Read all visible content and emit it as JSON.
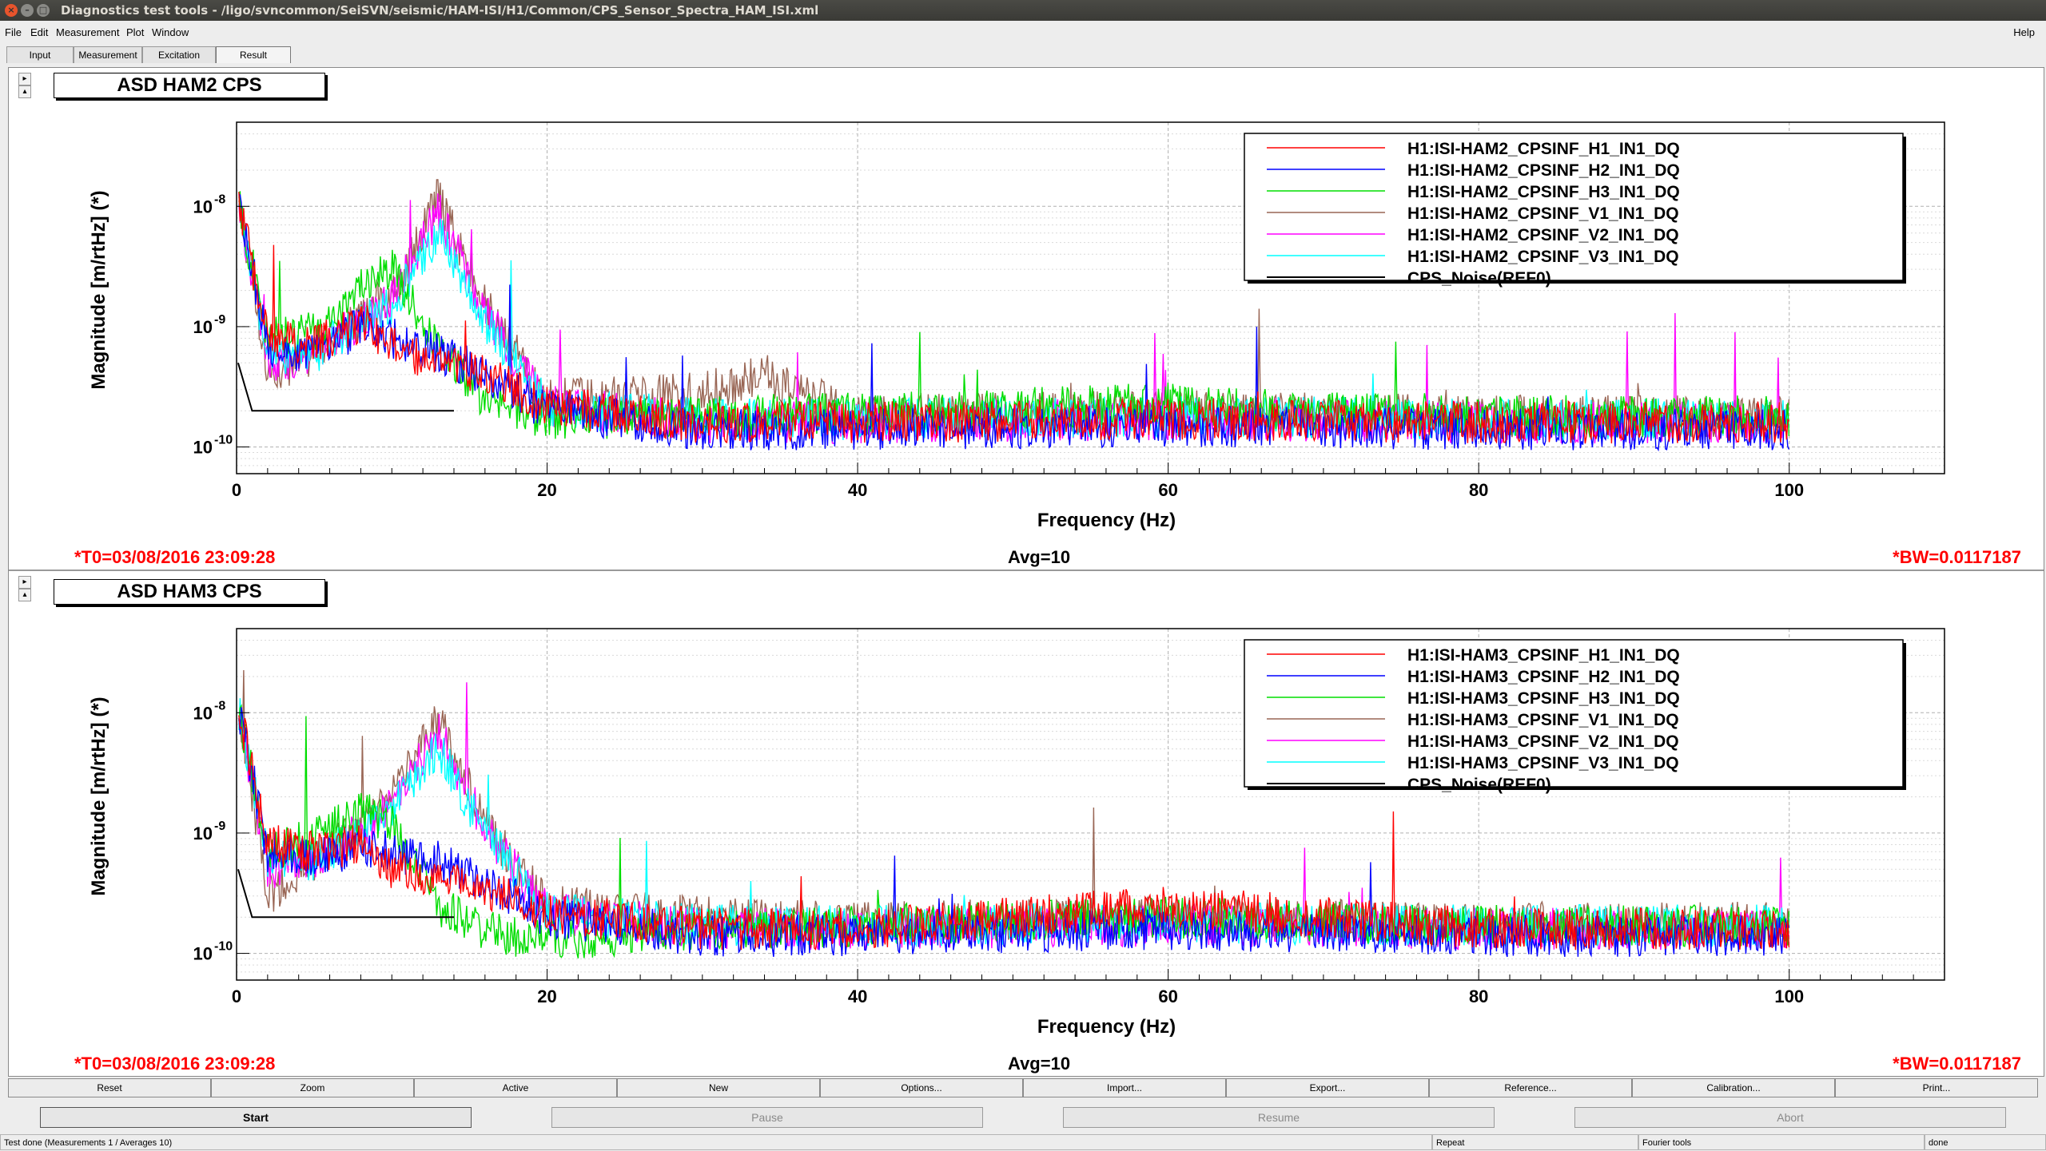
{
  "window": {
    "title": "Diagnostics test tools - /ligo/svncommon/SeiSVN/seismic/HAM-ISI/H1/Common/CPS_Sensor_Spectra_HAM_ISI.xml"
  },
  "menu": {
    "items": [
      "File",
      "Edit",
      "Measurement",
      "Plot",
      "Window"
    ],
    "help": "Help"
  },
  "tabs": [
    {
      "label": "Input"
    },
    {
      "label": "Measurement"
    },
    {
      "label": "Excitation"
    },
    {
      "label": "Result"
    }
  ],
  "panels": [
    {
      "title": "ASD HAM2 CPS",
      "t0": "*T0=03/08/2016 23:09:28",
      "avg": "Avg=10",
      "bw": "*BW=0.0117187",
      "legend": [
        {
          "name": "H1:ISI-HAM2_CPSINF_H1_IN1_DQ",
          "color": "#ff0000"
        },
        {
          "name": "H1:ISI-HAM2_CPSINF_H2_IN1_DQ",
          "color": "#0000ff"
        },
        {
          "name": "H1:ISI-HAM2_CPSINF_H3_IN1_DQ",
          "color": "#00dd00"
        },
        {
          "name": "H1:ISI-HAM2_CPSINF_V1_IN1_DQ",
          "color": "#996655"
        },
        {
          "name": "H1:ISI-HAM2_CPSINF_V2_IN1_DQ",
          "color": "#ff00ff"
        },
        {
          "name": "H1:ISI-HAM2_CPSINF_V3_IN1_DQ",
          "color": "#00ffff"
        },
        {
          "name": "CPS_Noise(REF0)",
          "color": "#000000"
        }
      ]
    },
    {
      "title": "ASD HAM3 CPS",
      "t0": "*T0=03/08/2016 23:09:28",
      "avg": "Avg=10",
      "bw": "*BW=0.0117187",
      "legend": [
        {
          "name": "H1:ISI-HAM3_CPSINF_H1_IN1_DQ",
          "color": "#ff0000"
        },
        {
          "name": "H1:ISI-HAM3_CPSINF_H2_IN1_DQ",
          "color": "#0000ff"
        },
        {
          "name": "H1:ISI-HAM3_CPSINF_H3_IN1_DQ",
          "color": "#00dd00"
        },
        {
          "name": "H1:ISI-HAM3_CPSINF_V1_IN1_DQ",
          "color": "#996655"
        },
        {
          "name": "H1:ISI-HAM3_CPSINF_V2_IN1_DQ",
          "color": "#ff00ff"
        },
        {
          "name": "H1:ISI-HAM3_CPSINF_V3_IN1_DQ",
          "color": "#00ffff"
        },
        {
          "name": "CPS_Noise(REF0)",
          "color": "#000000"
        }
      ]
    }
  ],
  "axes": {
    "xlabel": "Frequency (Hz)",
    "ylabel": "Magnitude [m/rtHz] (*)",
    "xticks": [
      "0",
      "20",
      "40",
      "60",
      "80",
      "100"
    ],
    "yticks": [
      "10",
      "10",
      "10"
    ],
    "ytick_exponents": [
      "-8",
      "-9",
      "-10"
    ]
  },
  "chart_data": [
    {
      "type": "line",
      "title": "ASD HAM2 CPS",
      "xlabel": "Frequency (Hz)",
      "ylabel": "Magnitude [m/rtHz] (*)",
      "xlim": [
        0,
        110
      ],
      "ylim": [
        6e-11,
        5e-08
      ],
      "yscale": "log",
      "grid": true,
      "legend_position": "top-right",
      "series": [
        {
          "name": "H1:ISI-HAM2_CPSINF_H1_IN1_DQ",
          "x": [
            0.2,
            2,
            5,
            8,
            10,
            13,
            16,
            20,
            30,
            40,
            60,
            80,
            100
          ],
          "y": [
            1e-08,
            8e-10,
            7e-10,
            1.1e-09,
            7e-10,
            5e-10,
            4e-10,
            2.2e-10,
            1.6e-10,
            1.6e-10,
            1.7e-10,
            1.6e-10,
            1.6e-10
          ]
        },
        {
          "name": "H1:ISI-HAM2_CPSINF_H2_IN1_DQ",
          "x": [
            0.2,
            2,
            5,
            8,
            10,
            13,
            16,
            20,
            30,
            40,
            60,
            80,
            100
          ],
          "y": [
            1e-08,
            7e-10,
            6e-10,
            1e-09,
            8e-10,
            6e-10,
            4e-10,
            2e-10,
            1.4e-10,
            1.4e-10,
            1.5e-10,
            1.4e-10,
            1.4e-10
          ]
        },
        {
          "name": "H1:ISI-HAM2_CPSINF_H3_IN1_DQ",
          "x": [
            0.2,
            2,
            5,
            8,
            10,
            13,
            16,
            20,
            30,
            40,
            60,
            80,
            100
          ],
          "y": [
            1e-08,
            8e-10,
            9e-10,
            2e-09,
            3e-09,
            7e-10,
            2.5e-10,
            1.7e-10,
            1.8e-10,
            1.9e-10,
            2.3e-10,
            1.8e-10,
            1.8e-10
          ]
        },
        {
          "name": "H1:ISI-HAM2_CPSINF_V1_IN1_DQ",
          "x": [
            0.2,
            2,
            5,
            8,
            10,
            13,
            16,
            20,
            30,
            34,
            40,
            60,
            80,
            100
          ],
          "y": [
            1e-08,
            4e-10,
            6e-10,
            1.2e-09,
            1.8e-09,
            1.2e-08,
            1.5e-09,
            2.5e-10,
            2.8e-10,
            4e-10,
            1.8e-10,
            2e-10,
            1.8e-10,
            1.8e-10
          ]
        },
        {
          "name": "H1:ISI-HAM2_CPSINF_V2_IN1_DQ",
          "x": [
            0.2,
            2,
            5,
            8,
            10,
            13,
            16,
            20,
            30,
            40,
            60,
            80,
            100
          ],
          "y": [
            1e-08,
            5e-10,
            6e-10,
            1.1e-09,
            1.6e-09,
            9e-09,
            1.3e-09,
            2.2e-10,
            1.6e-10,
            1.6e-10,
            1.7e-10,
            1.6e-10,
            1.6e-10
          ]
        },
        {
          "name": "H1:ISI-HAM2_CPSINF_V3_IN1_DQ",
          "x": [
            0.2,
            2,
            5,
            8,
            10,
            13,
            16,
            20,
            30,
            40,
            60,
            80,
            100
          ],
          "y": [
            1e-08,
            6e-10,
            6e-10,
            1.1e-09,
            1.5e-09,
            6e-09,
            1.1e-09,
            2.2e-10,
            1.7e-10,
            1.7e-10,
            1.8e-10,
            1.7e-10,
            1.7e-10
          ]
        },
        {
          "name": "CPS_Noise(REF0)",
          "x": [
            0.1,
            1,
            14
          ],
          "y": [
            5e-10,
            2e-10,
            2e-10
          ]
        }
      ]
    },
    {
      "type": "line",
      "title": "ASD HAM3 CPS",
      "xlabel": "Frequency (Hz)",
      "ylabel": "Magnitude [m/rtHz] (*)",
      "xlim": [
        0,
        110
      ],
      "ylim": [
        6e-11,
        5e-08
      ],
      "yscale": "log",
      "grid": true,
      "legend_position": "top-right",
      "series": [
        {
          "name": "H1:ISI-HAM3_CPSINF_H1_IN1_DQ",
          "x": [
            0.2,
            2,
            5,
            8,
            10,
            13,
            16,
            20,
            30,
            40,
            60,
            80,
            100
          ],
          "y": [
            1e-08,
            8e-10,
            7e-10,
            8e-10,
            5e-10,
            4e-10,
            3.5e-10,
            2.2e-10,
            1.6e-10,
            1.6e-10,
            2.5e-10,
            1.6e-10,
            1.6e-10
          ]
        },
        {
          "name": "H1:ISI-HAM3_CPSINF_H2_IN1_DQ",
          "x": [
            0.2,
            2,
            5,
            8,
            10,
            13,
            16,
            20,
            30,
            40,
            60,
            80,
            100
          ],
          "y": [
            1e-08,
            7e-10,
            6e-10,
            8e-10,
            7e-10,
            6e-10,
            4e-10,
            2e-10,
            1.4e-10,
            1.4e-10,
            1.6e-10,
            1.4e-10,
            1.4e-10
          ]
        },
        {
          "name": "H1:ISI-HAM3_CPSINF_H3_IN1_DQ",
          "x": [
            0.2,
            2,
            5,
            8,
            10,
            13,
            16,
            20,
            30,
            40,
            60,
            80,
            100
          ],
          "y": [
            1e-08,
            7e-10,
            9e-10,
            1.5e-09,
            1.2e-09,
            2.5e-10,
            1.5e-10,
            1.3e-10,
            1.6e-10,
            1.7e-10,
            2e-10,
            1.7e-10,
            1.7e-10
          ]
        },
        {
          "name": "H1:ISI-HAM3_CPSINF_V1_IN1_DQ",
          "x": [
            0.2,
            2,
            5,
            8,
            10,
            13,
            16,
            20,
            30,
            40,
            60,
            80,
            100
          ],
          "y": [
            1e-08,
            3e-10,
            6e-10,
            1.2e-09,
            2e-09,
            9e-09,
            1.2e-09,
            2.5e-10,
            2e-10,
            1.8e-10,
            2e-10,
            1.8e-10,
            1.8e-10
          ]
        },
        {
          "name": "H1:ISI-HAM3_CPSINF_V2_IN1_DQ",
          "x": [
            0.2,
            2,
            5,
            8,
            10,
            13,
            16,
            20,
            30,
            40,
            60,
            80,
            100
          ],
          "y": [
            1e-08,
            5e-10,
            6e-10,
            1.1e-09,
            1.8e-09,
            7e-09,
            1.1e-09,
            2.2e-10,
            1.6e-10,
            1.6e-10,
            1.7e-10,
            1.6e-10,
            1.6e-10
          ]
        },
        {
          "name": "H1:ISI-HAM3_CPSINF_V3_IN1_DQ",
          "x": [
            0.2,
            2,
            5,
            8,
            10,
            13,
            16,
            20,
            30,
            40,
            60,
            80,
            100
          ],
          "y": [
            1e-08,
            6e-10,
            6e-10,
            1e-09,
            1.6e-09,
            5e-09,
            1e-09,
            2.2e-10,
            1.7e-10,
            1.7e-10,
            1.8e-10,
            1.7e-10,
            1.7e-10
          ]
        },
        {
          "name": "CPS_Noise(REF0)",
          "x": [
            0.1,
            1,
            14
          ],
          "y": [
            5e-10,
            2e-10,
            2e-10
          ]
        }
      ]
    }
  ],
  "toolbar": [
    "Reset",
    "Zoom",
    "Active",
    "New",
    "Options...",
    "Import...",
    "Export...",
    "Reference...",
    "Calibration...",
    "Print..."
  ],
  "controls": {
    "start": "Start",
    "pause": "Pause",
    "resume": "Resume",
    "abort": "Abort"
  },
  "status": {
    "message": "Test done (Measurements 1 / Averages 10)",
    "repeat": "Repeat",
    "tools": "Fourier tools",
    "state": "done"
  }
}
